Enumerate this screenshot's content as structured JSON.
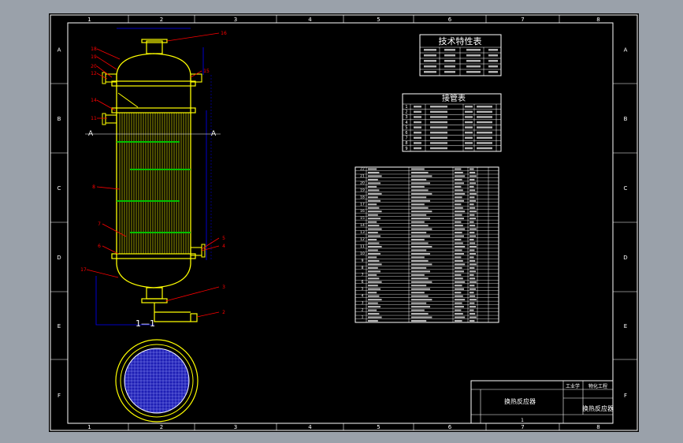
{
  "sheet": {
    "columns": [
      "1",
      "2",
      "3",
      "4",
      "5",
      "6",
      "7",
      "8"
    ],
    "rows": [
      "A",
      "B",
      "C",
      "D",
      "E",
      "F"
    ]
  },
  "vessel_labels": {
    "leaders": [
      "18",
      "19",
      "20",
      "12",
      "14",
      "11",
      "8",
      "7",
      "6",
      "17",
      "16",
      "15",
      "5",
      "4",
      "3",
      "2"
    ],
    "section_mark": "1—1",
    "section_left": "A",
    "section_right": "A"
  },
  "tech_table": {
    "title": "技术特性表"
  },
  "nozzle_table": {
    "title": "接管表",
    "rows": [
      "1",
      "2",
      "3",
      "4",
      "5",
      "6",
      "7",
      "8",
      "9"
    ]
  },
  "parts_list": {
    "row_numbers": [
      "22",
      "21",
      "20",
      "19",
      "18",
      "17",
      "16",
      "15",
      "14",
      "13",
      "12",
      "11",
      "10",
      "9",
      "8",
      "7",
      "6",
      "5",
      "4",
      "3",
      "2",
      "1"
    ]
  },
  "title_block": {
    "name_main": "换热反应器",
    "name_right": "换热反应器",
    "school": "工业学",
    "dept": "物化工程",
    "sheet_no": "1"
  },
  "colors": {
    "background": "#000000",
    "frame": "#ffffff",
    "vessel": "#ffff00",
    "dimension": "#0000ff",
    "leader": "#ff0000",
    "baffle": "#00c000",
    "tubesheet_fill": "#1e1eb4"
  }
}
